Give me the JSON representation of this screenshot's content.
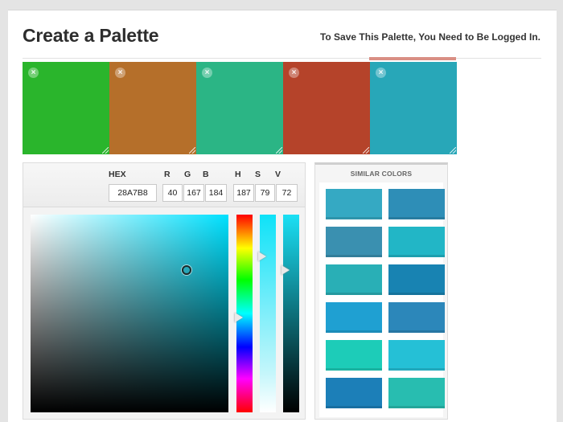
{
  "header": {
    "title": "Create a Palette",
    "login_note": "To Save This Palette, You Need to Be Logged In."
  },
  "palette": {
    "active_index": 4,
    "swatches": [
      {
        "color": "#2AB52C",
        "remove_icon": "close-icon"
      },
      {
        "color": "#B56F2A",
        "remove_icon": "close-icon"
      },
      {
        "color": "#2BB585",
        "remove_icon": "close-icon"
      },
      {
        "color": "#B5432A",
        "remove_icon": "close-icon"
      },
      {
        "color": "#28A7B8",
        "remove_icon": "close-icon"
      }
    ],
    "remove_glyph": "×"
  },
  "editor": {
    "hex_label": "HEX",
    "hex_value": "28A7B8",
    "r_label": "R",
    "r_value": "40",
    "g_label": "G",
    "g_value": "167",
    "b_label": "B",
    "b_value": "184",
    "h_label": "H",
    "h_value": "187",
    "s_label": "S",
    "s_value": "79",
    "v_label": "V",
    "v_value": "72",
    "hue_color": "#00E1FF",
    "saturation_fraction": 0.79,
    "value_fraction": 0.72,
    "hue_fraction": 0.52
  },
  "similar": {
    "title": "SIMILAR COLORS",
    "colors": [
      "#35A9C3",
      "#2E8EB7",
      "#3A90B0",
      "#22B6C6",
      "#29AFB6",
      "#1883B2",
      "#1FA0D2",
      "#2C87BA",
      "#1DCCB8",
      "#25C0D6",
      "#1C7FB8",
      "#28BDB0"
    ]
  }
}
